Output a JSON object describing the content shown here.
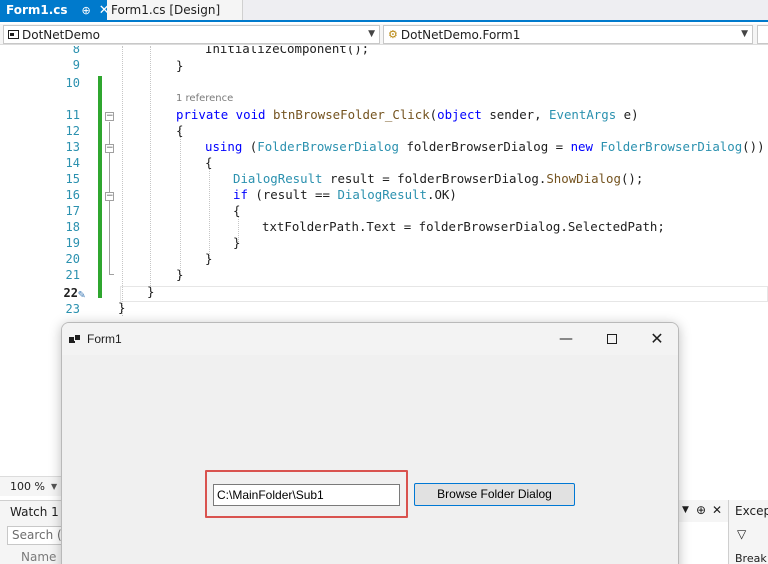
{
  "tabs": {
    "active_label": "Form1.cs",
    "pin_glyph": "⊕",
    "close_glyph": "✕",
    "design_label": "Form1.cs [Design]"
  },
  "navbar": {
    "project": "DotNetDemo",
    "class": "DotNetDemo.Form1",
    "member": ""
  },
  "editor": {
    "line_numbers": [
      "8",
      "9",
      "10",
      "11",
      "12",
      "13",
      "14",
      "15",
      "16",
      "17",
      "18",
      "19",
      "20",
      "21",
      "22",
      "23"
    ],
    "codelens": "1 reference",
    "code": {
      "l8": "InitializeComponent();",
      "l9": "}",
      "l11_kw": "private void",
      "l11_mt": "btnBrowseFolder_Click",
      "l11_a": "(",
      "l11_kw2": "object",
      "l11_b": " sender, ",
      "l11_ty": "EventArgs",
      "l11_c": " e)",
      "l12": "{",
      "l13_kw": "using",
      "l13_a": " (",
      "l13_ty": "FolderBrowserDialog",
      "l13_b": " folderBrowserDialog = ",
      "l13_kw2": "new",
      "l13_sp": " ",
      "l13_ty2": "FolderBrowserDialog",
      "l13_c": "())",
      "l14": "{",
      "l15_ty": "DialogResult",
      "l15_a": " result = folderBrowserDialog.",
      "l15_mt": "ShowDialog",
      "l15_b": "();",
      "l16_kw": "if",
      "l16_a": " (result == ",
      "l16_ty": "DialogResult",
      "l16_b": ".OK)",
      "l17": "{",
      "l18": "txtFolderPath.Text = folderBrowserDialog.SelectedPath;",
      "l19": "}",
      "l20": "}",
      "l21": "}",
      "l22": "}",
      "l23": "}"
    }
  },
  "zoom": {
    "value": "100 %"
  },
  "watch": {
    "title": "Watch 1",
    "search_placeholder": "Search (C",
    "column_name": "Name"
  },
  "exceptions": {
    "title": "Excepti",
    "break_label": "Break W"
  },
  "form": {
    "title": "Form1",
    "folder_path": "C:\\MainFolder\\Sub1",
    "browse_label": "Browse Folder Dialog"
  },
  "colors": {
    "accent": "#007acc",
    "change_marker": "#2fa62f",
    "highlight": "#d9534f"
  }
}
